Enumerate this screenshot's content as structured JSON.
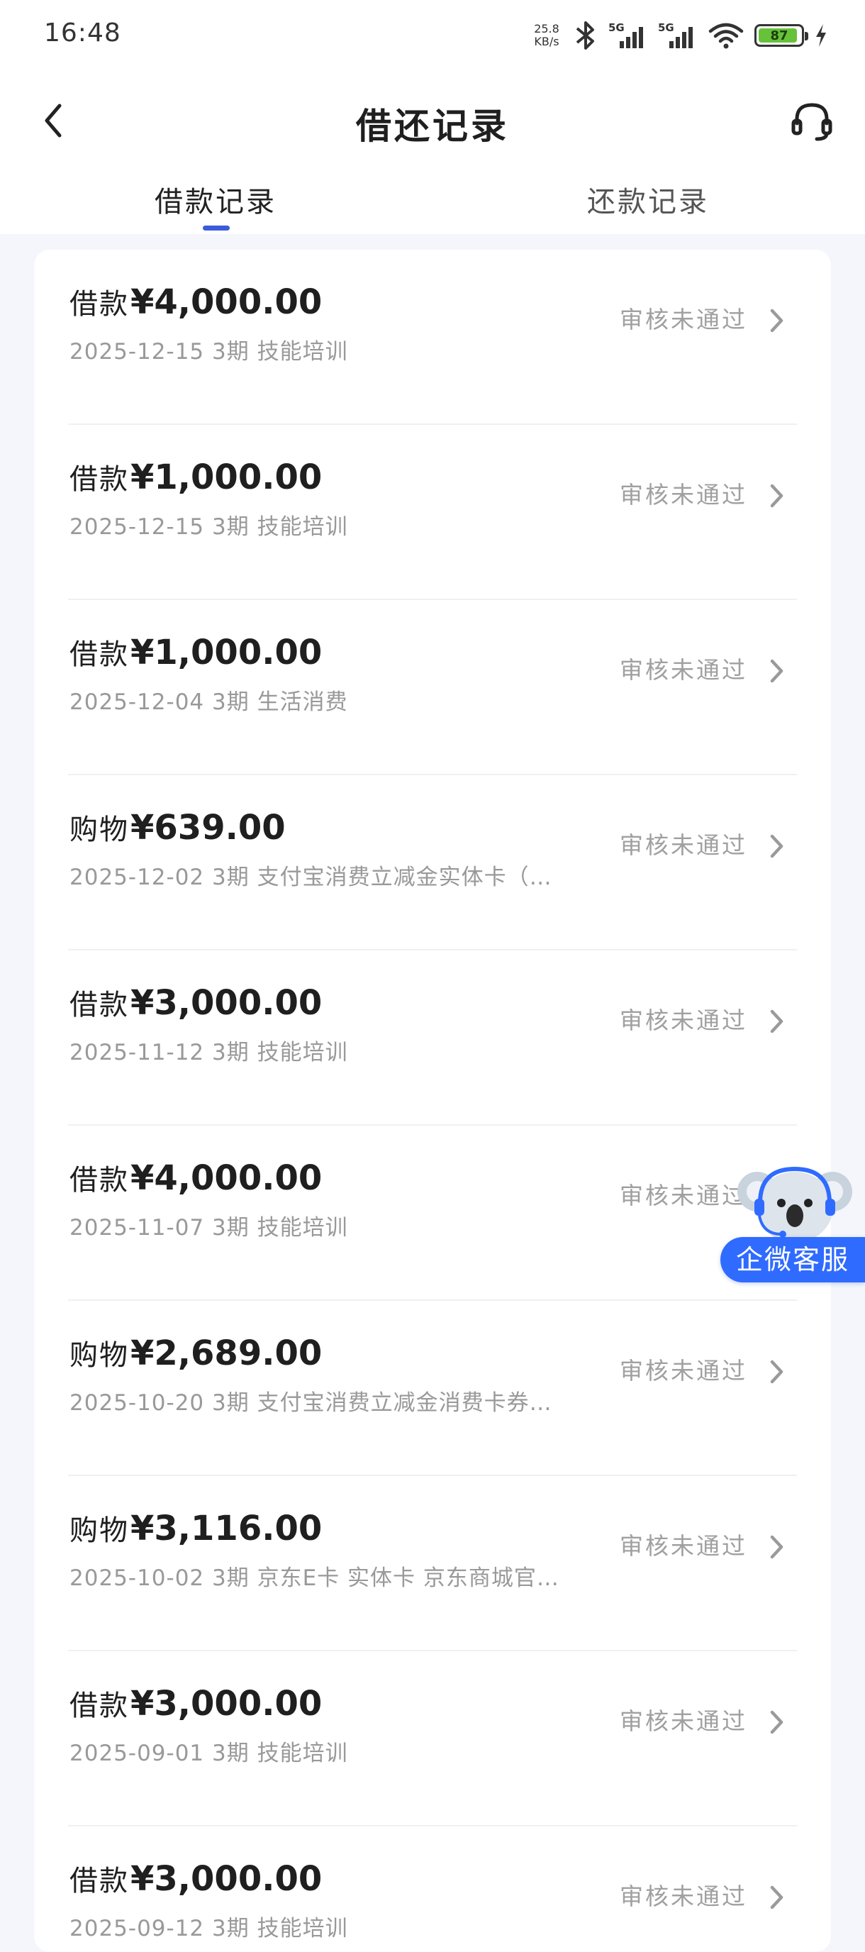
{
  "status_bar": {
    "time": "16:48",
    "net_speed_value": "25.8",
    "net_speed_unit": "KB/s",
    "signal_1_label": "5G",
    "signal_2_label": "5G",
    "battery_level": "87",
    "battery_color": "#67c23a"
  },
  "header": {
    "title": "借还记录",
    "back_icon": "chevron-left-icon",
    "service_icon": "headset-icon"
  },
  "tabs": [
    {
      "label": "借款记录",
      "active": true
    },
    {
      "label": "还款记录",
      "active": false
    }
  ],
  "accent_color": "#3b5bdb",
  "records": [
    {
      "type": "借款",
      "amount": "¥4,000.00",
      "detail": "2025-12-15 3期  技能培训",
      "status": "审核未通过"
    },
    {
      "type": "借款",
      "amount": "¥1,000.00",
      "detail": "2025-12-15 3期  技能培训",
      "status": "审核未通过"
    },
    {
      "type": "借款",
      "amount": "¥1,000.00",
      "detail": "2025-12-04 3期  生活消费",
      "status": "审核未通过"
    },
    {
      "type": "购物",
      "amount": "¥639.00",
      "detail": "2025-12-02 3期  支付宝消费立减金实体卡（…",
      "status": "审核未通过"
    },
    {
      "type": "借款",
      "amount": "¥3,000.00",
      "detail": "2025-11-12 3期  技能培训",
      "status": "审核未通过"
    },
    {
      "type": "借款",
      "amount": "¥4,000.00",
      "detail": "2025-11-07 3期  技能培训",
      "status": "审核未通过"
    },
    {
      "type": "购物",
      "amount": "¥2,689.00",
      "detail": "2025-10-20 3期  支付宝消费立减金消费卡券…",
      "status": "审核未通过"
    },
    {
      "type": "购物",
      "amount": "¥3,116.00",
      "detail": "2025-10-02 3期  京东E卡 实体卡 京东商城官…",
      "status": "审核未通过"
    },
    {
      "type": "借款",
      "amount": "¥3,000.00",
      "detail": "2025-09-01 3期  技能培训",
      "status": "审核未通过"
    },
    {
      "type": "借款",
      "amount": "¥3,000.00",
      "detail": "2025-09-12 3期  技能培训",
      "status": "审核未通过"
    }
  ],
  "float_service": {
    "label": "企微客服",
    "mascot_icon": "koala-mascot-icon",
    "color": "#2f6bff"
  }
}
